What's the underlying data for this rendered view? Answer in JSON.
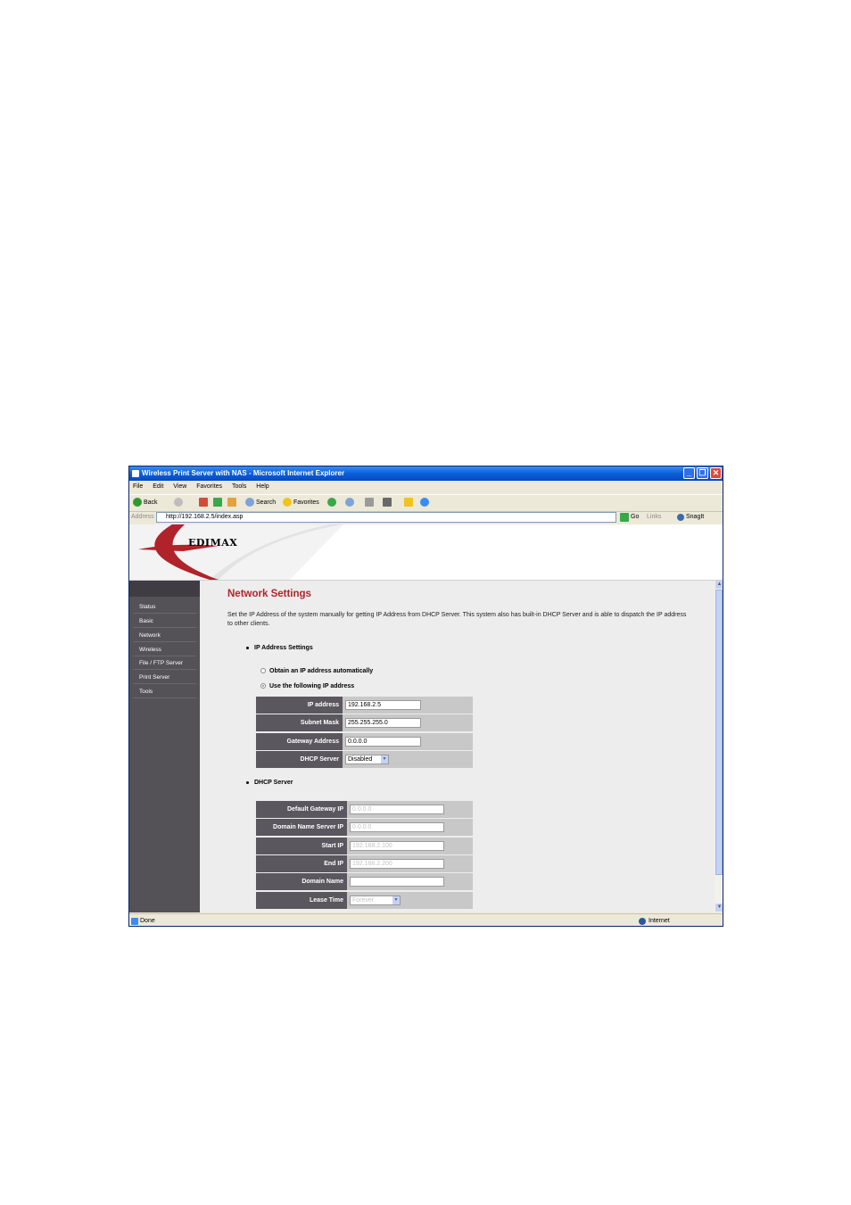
{
  "window": {
    "title": "Wireless Print Server with NAS - Microsoft Internet Explorer",
    "min": "_",
    "max": "❐",
    "close": "✕"
  },
  "menu": [
    "File",
    "Edit",
    "View",
    "Favorites",
    "Tools",
    "Help"
  ],
  "toolbar": {
    "back": "Back",
    "search": "Search",
    "favorites": "Favorites"
  },
  "address": {
    "label": "Address",
    "url": "http://192.168.2.5/index.asp",
    "go": "Go",
    "links": "Links",
    "snagit": "SnagIt"
  },
  "brand": {
    "logo": "EDIMAX"
  },
  "sidebar": {
    "items": [
      {
        "label": "Status"
      },
      {
        "label": "Basic"
      },
      {
        "label": "Network"
      },
      {
        "label": "Wireless"
      },
      {
        "label": "File / FTP Server"
      },
      {
        "label": "Print Server"
      },
      {
        "label": "Tools"
      }
    ]
  },
  "page": {
    "heading": "Network Settings",
    "description": "Set the IP Address of the system manually for getting IP Address from DHCP Server. This system also has built-in DHCP Server and is able to dispatch the IP address to other clients.",
    "ip_section": "IP Address Settings",
    "radio_auto": "Obtain an IP address automatically",
    "radio_manual": "Use the following IP address",
    "ip_fields": {
      "ip_label": "IP address",
      "ip_value": "192.168.2.5",
      "mask_label": "Subnet Mask",
      "mask_value": "255.255.255.0",
      "gw_label": "Gateway Address",
      "gw_value": "0.0.0.0",
      "dhcp_label": "DHCP Server",
      "dhcp_value": "Disabled"
    },
    "dhcp_section": "DHCP Server",
    "dhcp_fields": {
      "defgw_label": "Default Gateway IP",
      "defgw_value": "0.0.0.0",
      "dns_label": "Domain Name Server IP",
      "dns_value": "0.0.0.0",
      "start_label": "Start IP",
      "start_value": "192.168.2.100",
      "end_label": "End IP",
      "end_value": "192.168.2.200",
      "domain_label": "Domain Name",
      "domain_value": "",
      "lease_label": "Lease Time",
      "lease_value": "Forever"
    }
  },
  "status": {
    "left": "Done",
    "zone": "Internet"
  },
  "colors": {
    "heading": "#b0232a",
    "sidebar": "#545157",
    "titlebar": "#0a5fd8"
  }
}
